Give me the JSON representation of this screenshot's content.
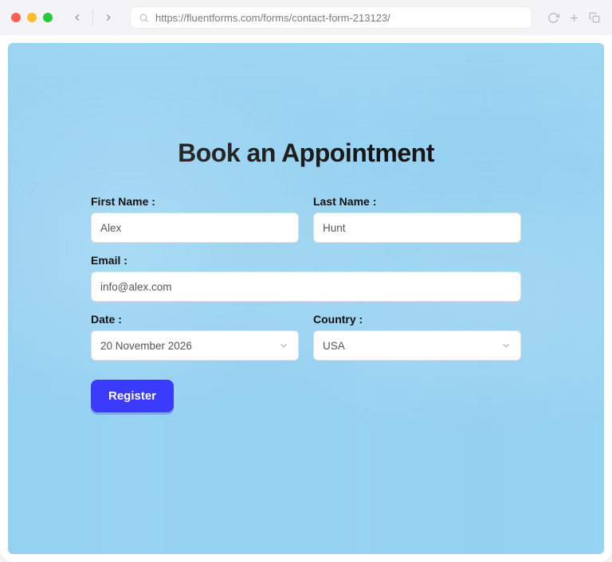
{
  "browser": {
    "url": "https://fluentforms.com/forms/contact-form-213123/"
  },
  "page": {
    "title": "Book an Appointment"
  },
  "form": {
    "first_name": {
      "label": "First Name :",
      "value": "Alex"
    },
    "last_name": {
      "label": "Last Name :",
      "value": "Hunt"
    },
    "email": {
      "label": "Email :",
      "value": "info@alex.com"
    },
    "date": {
      "label": "Date :",
      "value": "20 November 2026"
    },
    "country": {
      "label": "Country :",
      "value": "USA"
    },
    "submit_label": "Register"
  }
}
